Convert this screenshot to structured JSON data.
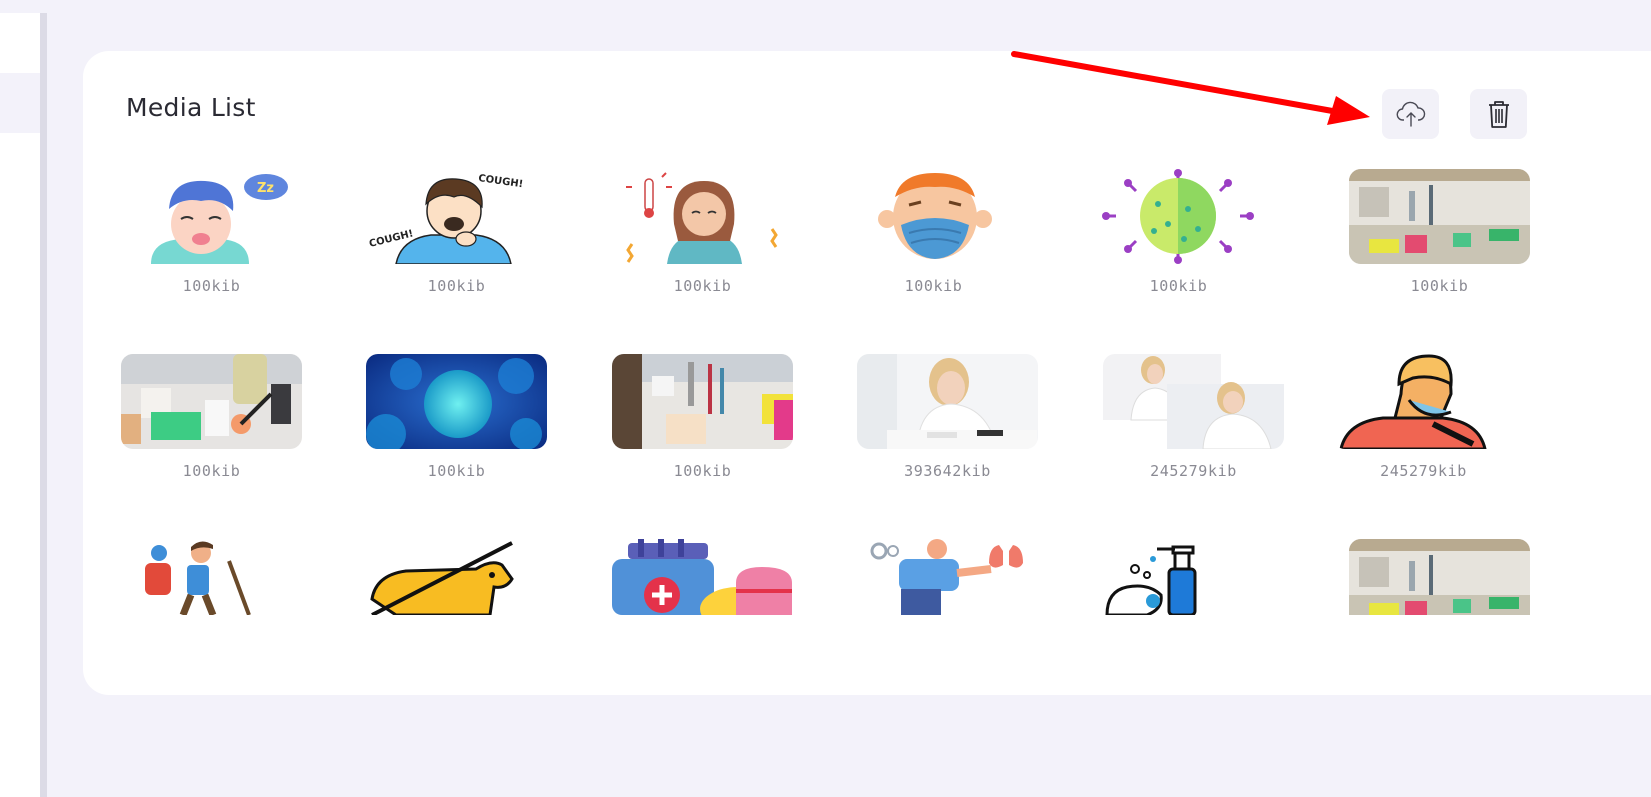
{
  "page": {
    "title": "Media List"
  },
  "actions": {
    "upload_icon": "cloud-upload-icon",
    "delete_icon": "trash-icon"
  },
  "media": [
    {
      "icon": "sleepy-person-icon",
      "size": "100kib"
    },
    {
      "icon": "coughing-person-icon",
      "size": "100kib"
    },
    {
      "icon": "fever-person-icon",
      "size": "100kib"
    },
    {
      "icon": "masked-person-icon",
      "size": "100kib"
    },
    {
      "icon": "virus-icon",
      "size": "100kib"
    },
    {
      "icon": "laboratory-photo",
      "size": "100kib"
    },
    {
      "icon": "lab-pipette-photo",
      "size": "100kib"
    },
    {
      "icon": "blue-virus-photo",
      "size": "100kib"
    },
    {
      "icon": "lab-test-tubes-photo",
      "size": "100kib"
    },
    {
      "icon": "doctor-writing-photo",
      "size": "393642kib"
    },
    {
      "icon": "doctor-collage-photo",
      "size": "245279kib"
    },
    {
      "icon": "sneezing-person-icon",
      "size": "245279kib"
    },
    {
      "icon": "hiker-icon",
      "size": ""
    },
    {
      "icon": "no-dogs-icon",
      "size": ""
    },
    {
      "icon": "medicine-pills-icon",
      "size": ""
    },
    {
      "icon": "lungs-person-icon",
      "size": ""
    },
    {
      "icon": "hand-sanitizer-icon",
      "size": ""
    },
    {
      "icon": "laboratory-photo-2",
      "size": ""
    }
  ]
}
